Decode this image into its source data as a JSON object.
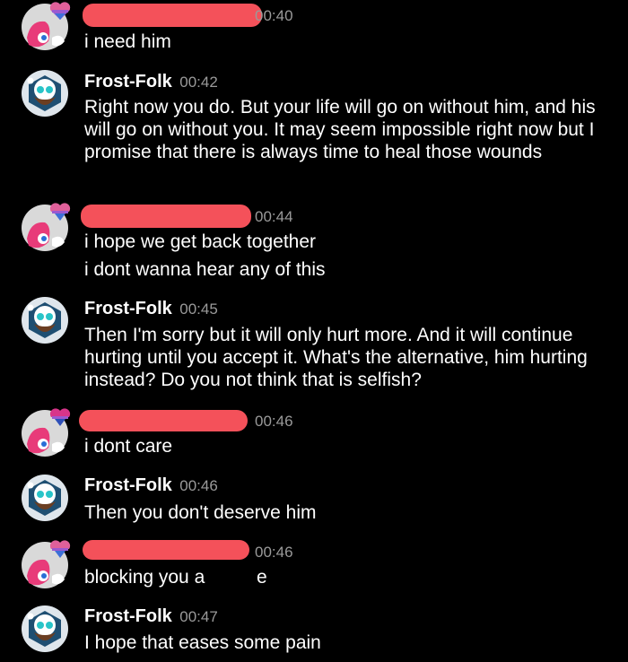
{
  "messages": [
    {
      "author": "",
      "time": "00:40",
      "lines": [
        "i need him"
      ]
    },
    {
      "author": "Frost-Folk",
      "time": "00:42",
      "lines": [
        "Right now you do. But your life will go on without him, and his will go on without you. It may seem impossible right now but I promise that there is always time to heal those wounds"
      ]
    },
    {
      "author": "",
      "time": "00:44",
      "lines": [
        "i hope we get back together",
        "i dont wanna hear any of this"
      ]
    },
    {
      "author": "Frost-Folk",
      "time": "00:45",
      "lines": [
        "Then I'm sorry but it will only hurt more. And it will continue hurting until you accept it. What's the alternative, him hurting instead? Do you not think that is selfish?"
      ]
    },
    {
      "author": "",
      "time": "00:46",
      "lines": [
        "i dont care"
      ]
    },
    {
      "author": "Frost-Folk",
      "time": "00:46",
      "lines": [
        "Then you don't deserve him"
      ]
    },
    {
      "author": "",
      "time": "00:46",
      "lines": [
        "blocking you a",
        "e"
      ]
    },
    {
      "author": "Frost-Folk",
      "time": "00:47",
      "lines": [
        "I hope that eases some pain"
      ]
    }
  ],
  "colors": {
    "background": "#000000",
    "text": "#ffffff",
    "timestamp": "#9a9a9a",
    "redaction": "#f4515a"
  },
  "icons": {
    "user_avatar": "pink-character-avatar-icon",
    "frost_avatar": "bearded-snowman-avatar-icon",
    "badge": "heart-badge-icon"
  }
}
